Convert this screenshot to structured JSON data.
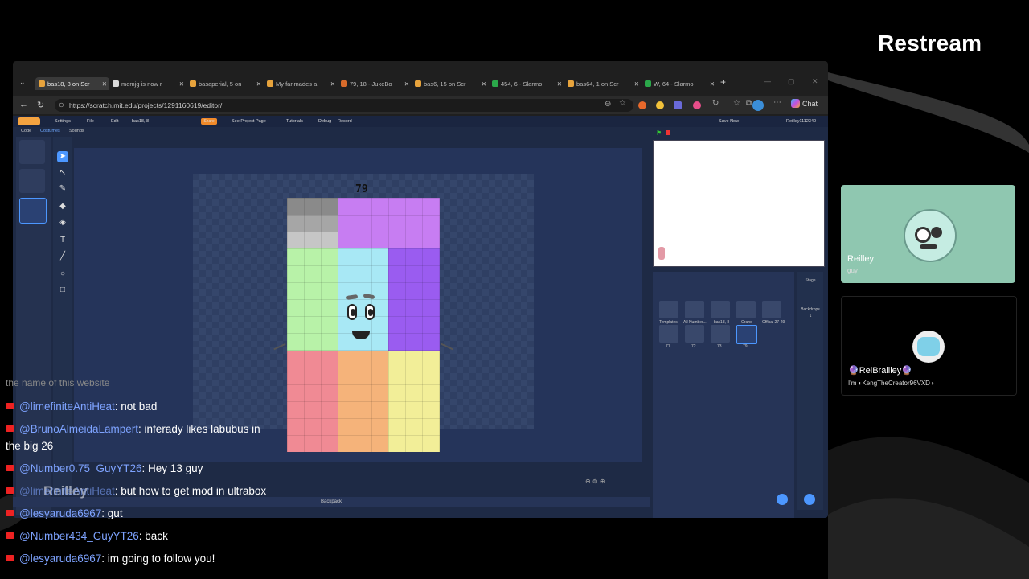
{
  "brand": "Restream",
  "browser": {
    "tabs": [
      {
        "label": "bas18, 8 on Scr",
        "active": true,
        "color": "#e7a33c"
      },
      {
        "label": "memjg is now r",
        "active": false,
        "color": "#d9d9d9"
      },
      {
        "label": "basaperial, 5 on",
        "active": false,
        "color": "#e7a33c"
      },
      {
        "label": "My fanmades a",
        "active": false,
        "color": "#e7a33c"
      },
      {
        "label": "79, 18 - JukeBo",
        "active": false,
        "color": "#d86b2b"
      },
      {
        "label": "bas6, 15 on Scr",
        "active": false,
        "color": "#e7a33c"
      },
      {
        "label": "454, 6 - Slarmo",
        "active": false,
        "color": "#2ba84a"
      },
      {
        "label": "bas64, 1 on Scr",
        "active": false,
        "color": "#e7a33c"
      },
      {
        "label": "W, 64 - Slarmo",
        "active": false,
        "color": "#2ba84a"
      }
    ],
    "url": "https://scratch.mit.edu/projects/1291160619/editor/",
    "chat_label": "Chat"
  },
  "scratch": {
    "menu": [
      "Settings",
      "File",
      "Edit",
      "bas18, 8",
      "Share",
      "See Project Page",
      "Tutorials",
      "Debug",
      "Record",
      "Save Now",
      "Reilley1112340"
    ],
    "editor_tabs": [
      "Code",
      "Costumes",
      "Sounds"
    ],
    "costume_number_label": "79",
    "backpack_label": "Backpack",
    "sprite_labels": [
      "Templates",
      "All Number...",
      "bas18, 8",
      "Grand",
      "Offical 27-29",
      "71",
      "72",
      "73",
      "79"
    ],
    "stage_label": "Stage",
    "backdrops_label": "Backdrops",
    "backdrops_count": "1"
  },
  "cards": [
    {
      "name": "Reilley",
      "subtitle": "guy"
    },
    {
      "name": "🔮ReiBrailley🔮",
      "subtitle": "I'm ◐KengTheCreator96VXD◑"
    }
  ],
  "chat": {
    "cut_line": "the name of this website",
    "messages": [
      {
        "user": "@limefiniteAntiHeat",
        "text": "not bad"
      },
      {
        "user": "@BrunoAlmeidaLampert",
        "text": "inferady likes labubus in"
      },
      {
        "user": "",
        "text": "the big 26"
      },
      {
        "user": "@Number0.75_GuyYT26",
        "text": "Hey 13 guy"
      },
      {
        "user": "@limefiniteAntiHeat",
        "text": "but how to get mod in ultrabox"
      },
      {
        "user": "@lesyaruda6967",
        "text": "gut"
      },
      {
        "user": "@Number434_GuyYT26",
        "text": "back"
      },
      {
        "user": "@lesyaruda6967",
        "text": "im going to follow you!"
      }
    ],
    "overlay_name": "Reilley"
  },
  "colors": {
    "gray": "#8a8a8a",
    "violet": "#c77df2",
    "green": "#b8f2a8",
    "cyan": "#a8e8f5",
    "purple": "#9a5cf0",
    "pink": "#f08a94",
    "orange": "#f5b37a",
    "yellow": "#f2ee98"
  }
}
